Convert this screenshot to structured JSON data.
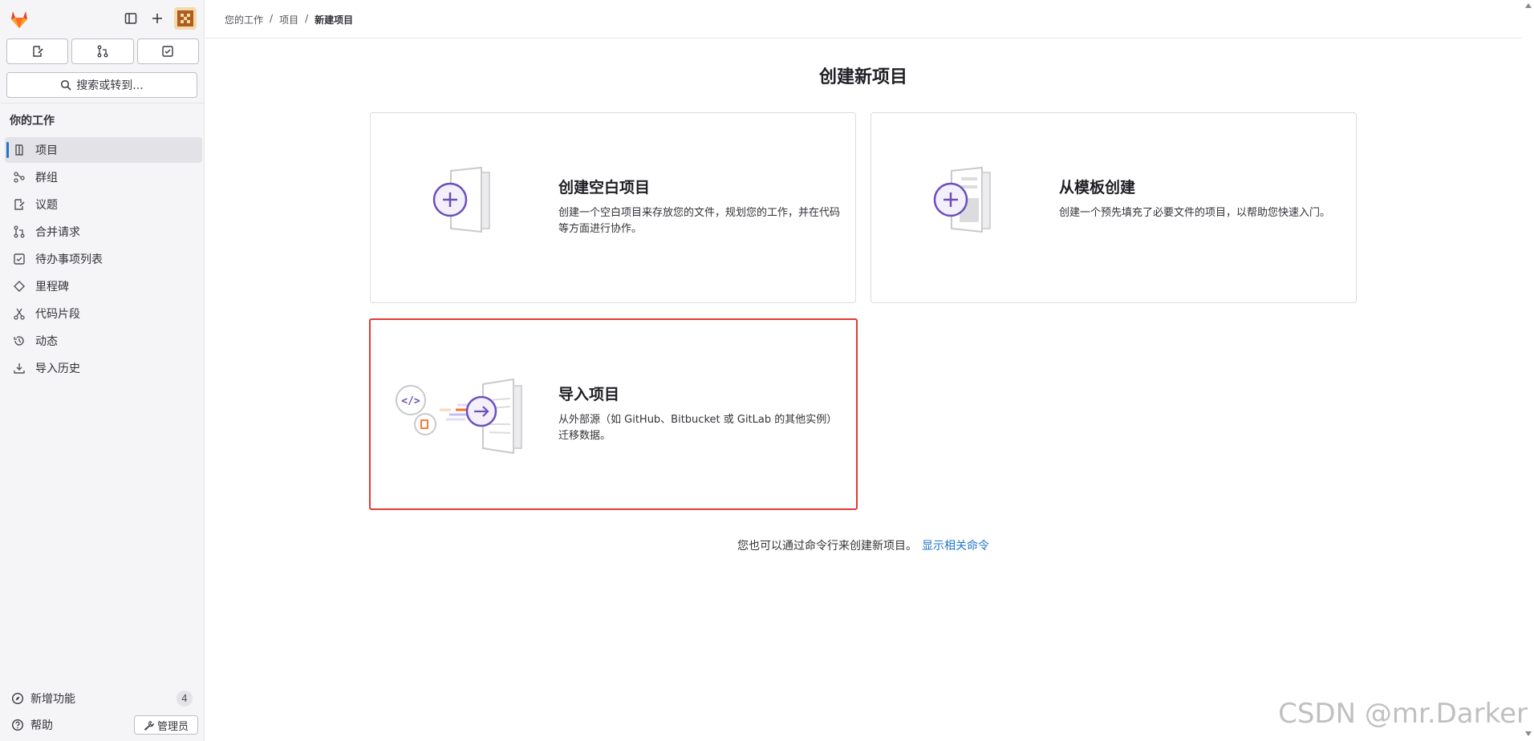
{
  "sidebar": {
    "quick_actions": [
      "issues-assigned",
      "merge-requests",
      "todo-items"
    ],
    "search_label": "搜索或转到...",
    "section_title": "你的工作",
    "items": [
      {
        "label": "项目",
        "icon": "project-icon",
        "active": true
      },
      {
        "label": "群组",
        "icon": "group-icon"
      },
      {
        "label": "议题",
        "icon": "issues-icon"
      },
      {
        "label": "合并请求",
        "icon": "merge-request-icon"
      },
      {
        "label": "待办事项列表",
        "icon": "todo-icon"
      },
      {
        "label": "里程碑",
        "icon": "milestone-icon"
      },
      {
        "label": "代码片段",
        "icon": "snippet-icon"
      },
      {
        "label": "动态",
        "icon": "history-icon"
      },
      {
        "label": "导入历史",
        "icon": "import-icon"
      }
    ],
    "whats_new": {
      "label": "新增功能",
      "count": "4"
    },
    "help_label": "帮助",
    "admin_label": "管理员"
  },
  "breadcrumb": [
    "您的工作",
    "项目",
    "新建项目"
  ],
  "page_title": "创建新项目",
  "cards": [
    {
      "title": "创建空白项目",
      "desc": "创建一个空白项目来存放您的文件，规划您的工作，并在代码等方面进行协作。"
    },
    {
      "title": "从模板创建",
      "desc": "创建一个预先填充了必要文件的项目，以帮助您快速入门。"
    },
    {
      "title": "导入项目",
      "desc": "从外部源（如 GitHub、Bitbucket 或 GitLab 的其他实例）迁移数据。"
    }
  ],
  "footer": {
    "text": "您也可以通过命令行来创建新项目。",
    "link": "显示相关命令"
  },
  "watermark": "CSDN @mr.Darker",
  "colors": {
    "accent": "#1f75cb",
    "illustration": "#6b4fbb",
    "highlight": "#e53935",
    "brand": "#e24329"
  }
}
